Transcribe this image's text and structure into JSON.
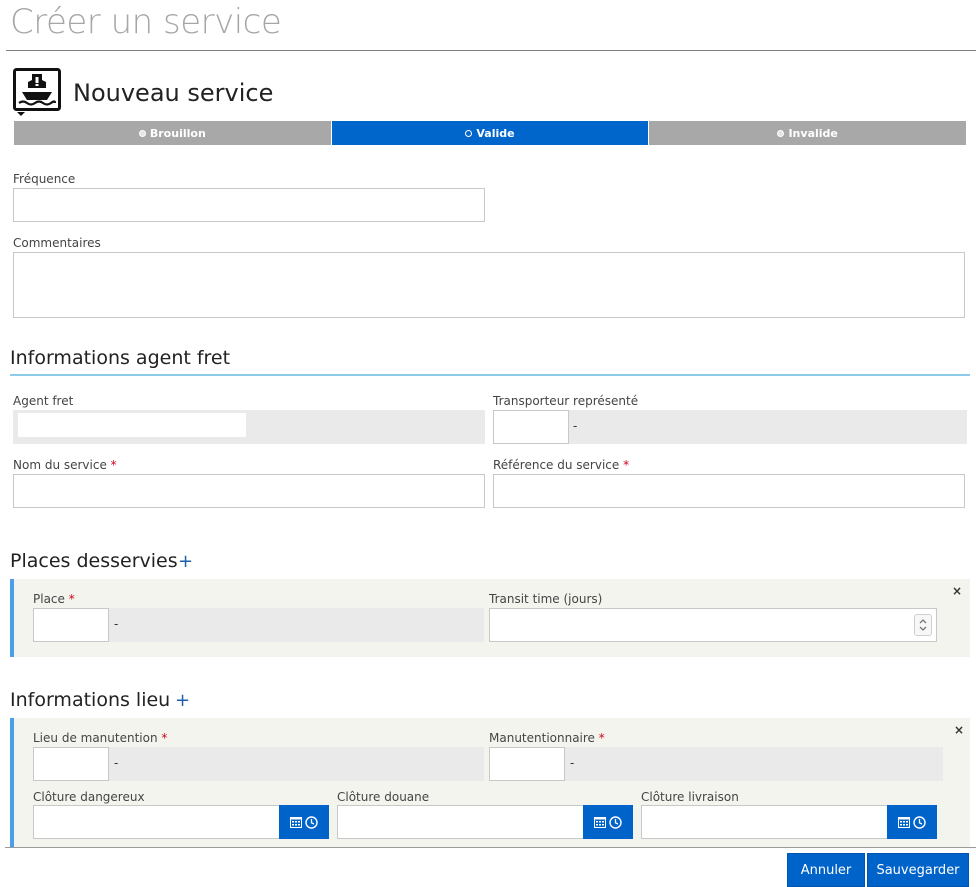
{
  "page": {
    "title": "Créer un service"
  },
  "entity": {
    "title": "Nouveau service",
    "icon": "ship-icon"
  },
  "status": {
    "steps": [
      {
        "label": "Brouillon",
        "active": false
      },
      {
        "label": "Valide",
        "active": true
      },
      {
        "label": "Invalide",
        "active": false
      }
    ]
  },
  "form": {
    "frequence_label": "Fréquence",
    "frequence_value": "",
    "commentaires_label": "Commentaires",
    "commentaires_value": ""
  },
  "agent_section": {
    "title": "Informations agent fret",
    "agent_fret_label": "Agent fret",
    "agent_fret_value": "",
    "transporteur_label": "Transporteur représenté",
    "transporteur_code": "",
    "transporteur_name": "-",
    "nom_service_label": "Nom du service",
    "nom_service_value": "",
    "reference_label": "Référence du service",
    "reference_value": "",
    "required_mark": "*"
  },
  "places_section": {
    "title": "Places desservies",
    "add_symbol": "+",
    "close_symbol": "×",
    "place_label": "Place",
    "place_code": "",
    "place_name": "-",
    "transit_label": "Transit time (jours)",
    "transit_value": ""
  },
  "lieu_section": {
    "title": "Informations lieu",
    "add_symbol": "+",
    "close_symbol": "×",
    "lieu_label": "Lieu de manutention",
    "lieu_code": "",
    "lieu_name": "-",
    "manutentionnaire_label": "Manutentionnaire",
    "manutentionnaire_code": "",
    "manutentionnaire_name": "-",
    "cloture_dangereux_label": "Clôture dangereux",
    "cloture_douane_label": "Clôture douane",
    "cloture_livraison_label": "Clôture livraison"
  },
  "footer": {
    "cancel_label": "Annuler",
    "save_label": "Sauvegarder"
  },
  "colors": {
    "accent": "#0063c9",
    "section_rule": "#8ecbe8",
    "panel_border": "#4d9ee8"
  }
}
